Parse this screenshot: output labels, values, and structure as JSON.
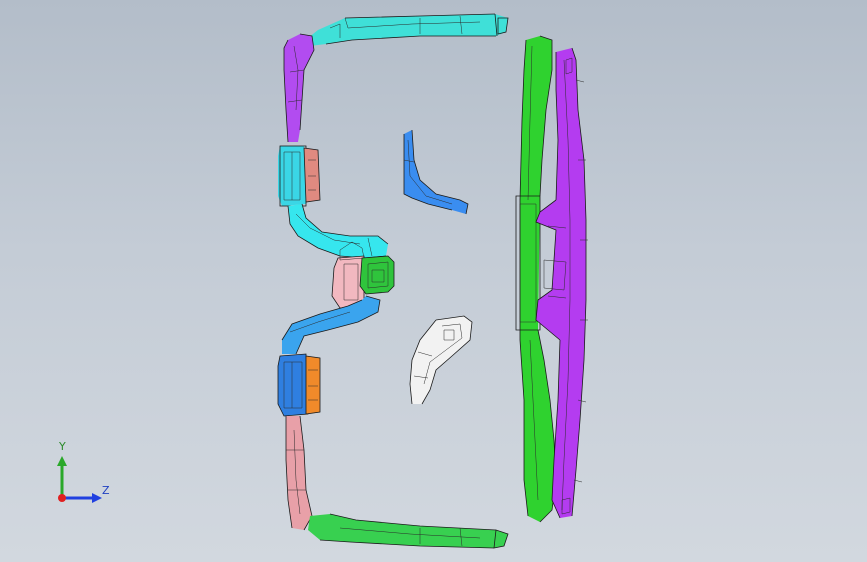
{
  "viewport": {
    "background_top": "#b3bdc9",
    "background_bottom": "#d2d8df"
  },
  "parts": [
    {
      "name": "upper-duct",
      "color": "#3fe0d8",
      "icon": "duct-part"
    },
    {
      "name": "upper-left-bracket",
      "color": "#b24cf0",
      "icon": "bracket-part"
    },
    {
      "name": "upper-vent-housing",
      "color": "#3ad6e6",
      "icon": "vent-part"
    },
    {
      "name": "upper-vent-cap",
      "color": "#e08a80",
      "icon": "cap-part"
    },
    {
      "name": "center-s-duct",
      "color": "#36e6ee",
      "icon": "duct-part"
    },
    {
      "name": "center-connector",
      "color": "#2fc43c",
      "icon": "connector-part"
    },
    {
      "name": "center-pink-block",
      "color": "#f2b8c0",
      "icon": "block-part"
    },
    {
      "name": "lower-s-duct",
      "color": "#3aa4ee",
      "icon": "duct-part"
    },
    {
      "name": "lower-vent-housing",
      "color": "#2f7fe0",
      "icon": "vent-part"
    },
    {
      "name": "lower-vent-cap",
      "color": "#f08a2a",
      "icon": "cap-part"
    },
    {
      "name": "lower-left-bracket",
      "color": "#e8a0a8",
      "icon": "bracket-part"
    },
    {
      "name": "lower-duct",
      "color": "#38d050",
      "icon": "duct-part"
    },
    {
      "name": "blue-corner-piece",
      "color": "#3a8df0",
      "icon": "corner-part"
    },
    {
      "name": "white-bracket-piece",
      "color": "#f2f2f2",
      "icon": "bracket-part"
    },
    {
      "name": "green-frame-rail",
      "color": "#2fd22f",
      "icon": "rail-part"
    },
    {
      "name": "purple-panel",
      "color": "#b43cf0",
      "icon": "panel-part"
    }
  ],
  "triad": {
    "y_label": "Y",
    "z_label": "Z",
    "y_color": "#2aa82a",
    "z_color": "#2040e0",
    "x_color": "#e02020"
  }
}
